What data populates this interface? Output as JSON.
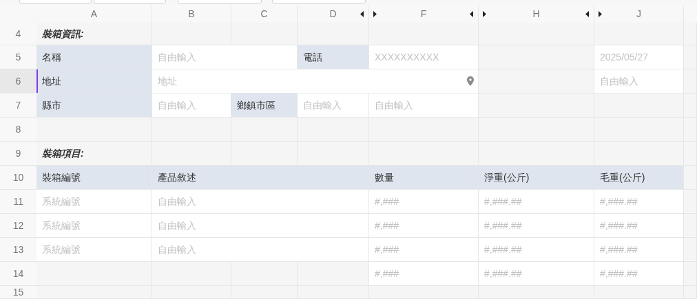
{
  "toolbar": {
    "buttons": [
      {
        "kind": "plain"
      },
      {
        "kind": "plain"
      },
      {
        "kind": "plain"
      },
      {
        "kind": "plain"
      }
    ]
  },
  "columns": [
    {
      "label": "A"
    },
    {
      "label": "B"
    },
    {
      "label": "C"
    },
    {
      "label": "D",
      "hidden_after": true
    },
    {
      "label": "F",
      "hidden_before": true,
      "hidden_after": true
    },
    {
      "label": "H",
      "hidden_before": true,
      "hidden_after": true
    },
    {
      "label": "J",
      "hidden_before": true
    }
  ],
  "rows": [
    {
      "number": "4",
      "selected": false,
      "cells": [
        {
          "kind": "section",
          "text": "裝箱資訊:"
        }
      ]
    },
    {
      "number": "5",
      "selected": false,
      "cells": [
        {
          "kind": "label",
          "text": "名稱"
        },
        {
          "kind": "input",
          "placeholder": "自由輸入"
        },
        {
          "kind": "merged"
        },
        {
          "kind": "label",
          "text": "電話"
        },
        {
          "kind": "input",
          "placeholder": "XXXXXXXXXX"
        },
        {
          "kind": "empty"
        },
        {
          "kind": "input",
          "placeholder": "2025/05/27"
        }
      ]
    },
    {
      "number": "6",
      "selected": true,
      "cells": [
        {
          "kind": "label",
          "text": "地址"
        },
        {
          "kind": "address",
          "placeholder": "地址"
        },
        {
          "kind": "merged"
        },
        {
          "kind": "merged"
        },
        {
          "kind": "merged"
        },
        {
          "kind": "empty"
        },
        {
          "kind": "input",
          "placeholder": "自由輸入"
        }
      ]
    },
    {
      "number": "7",
      "selected": false,
      "cells": [
        {
          "kind": "label",
          "text": "縣市"
        },
        {
          "kind": "input",
          "placeholder": "自由輸入"
        },
        {
          "kind": "label",
          "text": "鄉鎮市區"
        },
        {
          "kind": "input",
          "placeholder": "自由輸入"
        },
        {
          "kind": "input",
          "placeholder": "自由輸入"
        }
      ]
    },
    {
      "number": "8",
      "selected": false,
      "cells": []
    },
    {
      "number": "9",
      "selected": false,
      "cells": [
        {
          "kind": "section",
          "text": "裝箱項目:"
        }
      ]
    },
    {
      "number": "10",
      "selected": false,
      "cells": [
        {
          "kind": "header",
          "text": "裝箱編號"
        },
        {
          "kind": "header",
          "text": "產品敘述"
        },
        {
          "kind": "merged"
        },
        {
          "kind": "merged"
        },
        {
          "kind": "header",
          "text": "數量"
        },
        {
          "kind": "header",
          "text": "淨重(公斤)"
        },
        {
          "kind": "header",
          "text": "毛重(公斤)"
        }
      ]
    },
    {
      "number": "11",
      "selected": false,
      "cells": [
        {
          "kind": "input",
          "placeholder": "系統編號"
        },
        {
          "kind": "input",
          "placeholder": "自由輸入"
        },
        {
          "kind": "merged"
        },
        {
          "kind": "merged"
        },
        {
          "kind": "input",
          "placeholder": "#,###"
        },
        {
          "kind": "input",
          "placeholder": "#,###.##"
        },
        {
          "kind": "input",
          "placeholder": "#,###.##"
        }
      ]
    },
    {
      "number": "12",
      "selected": false,
      "cells": [
        {
          "kind": "input",
          "placeholder": "系統編號"
        },
        {
          "kind": "input",
          "placeholder": "自由輸入"
        },
        {
          "kind": "merged"
        },
        {
          "kind": "merged"
        },
        {
          "kind": "input",
          "placeholder": "#,###"
        },
        {
          "kind": "input",
          "placeholder": "#,###.##"
        },
        {
          "kind": "input",
          "placeholder": "#,###.##"
        }
      ]
    },
    {
      "number": "13",
      "selected": false,
      "cells": [
        {
          "kind": "input",
          "placeholder": "系統編號"
        },
        {
          "kind": "input",
          "placeholder": "自由輸入"
        },
        {
          "kind": "merged"
        },
        {
          "kind": "merged"
        },
        {
          "kind": "input",
          "placeholder": "#,###"
        },
        {
          "kind": "input",
          "placeholder": "#,###.##"
        },
        {
          "kind": "input",
          "placeholder": "#,###.##"
        }
      ]
    },
    {
      "number": "14",
      "selected": false,
      "cells": [
        {
          "kind": "empty"
        },
        {
          "kind": "empty"
        },
        {
          "kind": "empty"
        },
        {
          "kind": "empty"
        },
        {
          "kind": "input",
          "placeholder": "#,###"
        },
        {
          "kind": "input",
          "placeholder": "#,###.##"
        },
        {
          "kind": "input",
          "placeholder": "#,###.##"
        }
      ]
    },
    {
      "number": "15",
      "selected": false,
      "cells": []
    }
  ]
}
